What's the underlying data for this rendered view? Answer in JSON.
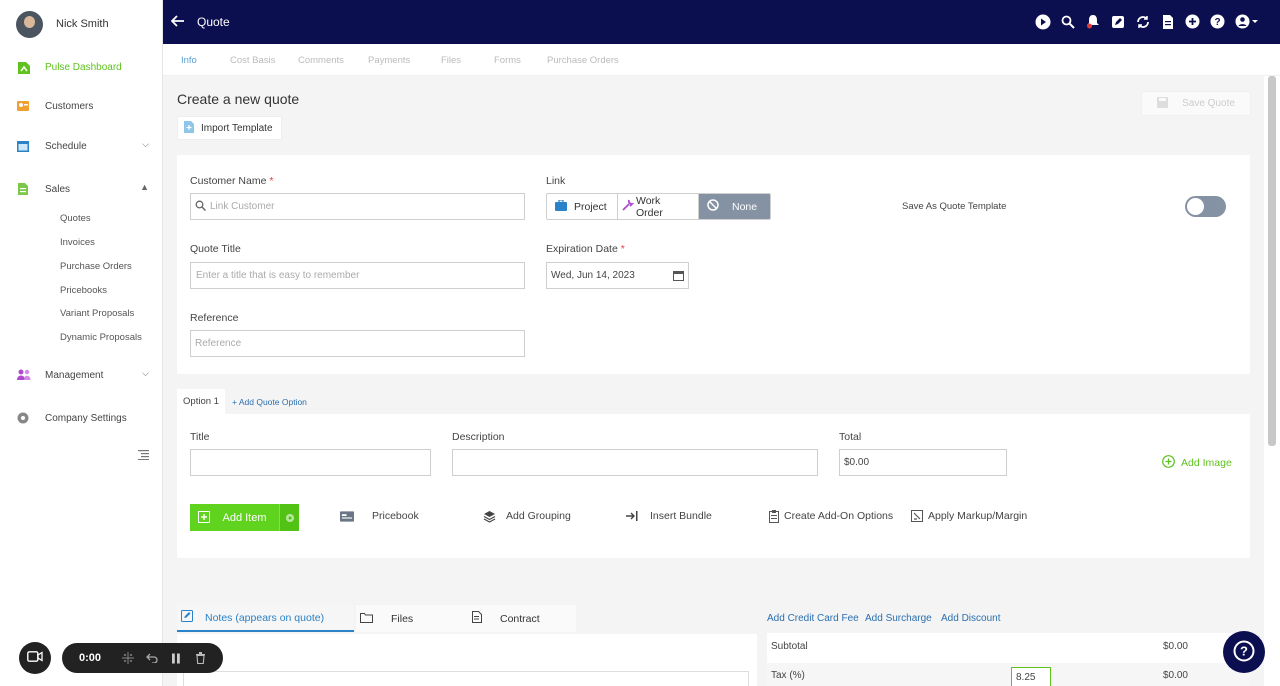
{
  "user": {
    "name": "Nick Smith"
  },
  "sidebar": {
    "items": [
      {
        "label": "Pulse Dashboard",
        "color": "#5fc21d"
      },
      {
        "label": "Customers"
      },
      {
        "label": "Schedule"
      },
      {
        "label": "Sales"
      },
      {
        "label": "Management"
      },
      {
        "label": "Company Settings"
      }
    ],
    "sales_sub": [
      "Quotes",
      "Invoices",
      "Purchase Orders",
      "Pricebooks",
      "Variant Proposals",
      "Dynamic Proposals"
    ]
  },
  "header": {
    "title": "Quote"
  },
  "tabs": [
    "Info",
    "Cost Basis",
    "Comments",
    "Payments",
    "Files",
    "Forms",
    "Purchase Orders"
  ],
  "page": {
    "title": "Create a new quote",
    "import_template": "Import Template",
    "save_quote": "Save Quote"
  },
  "form": {
    "customer_name_label": "Customer Name",
    "required_mark": "*",
    "customer_placeholder": "Link Customer",
    "link_label": "Link",
    "link_options": [
      "Project",
      "Work Order",
      "None"
    ],
    "save_template_label": "Save As Quote Template",
    "quote_title_label": "Quote Title",
    "quote_title_placeholder": "Enter a title that is easy to remember",
    "expiration_label": "Expiration Date",
    "expiration_value": "Wed, Jun 14, 2023",
    "reference_label": "Reference",
    "reference_placeholder": "Reference"
  },
  "option": {
    "tab": "Option 1",
    "add_option": "+ Add Quote Option",
    "title_label": "Title",
    "description_label": "Description",
    "total_label": "Total",
    "total_value": "$0.00",
    "add_image": "Add Image",
    "add_item": "Add Item",
    "actions": [
      "Pricebook",
      "Add Grouping",
      "Insert Bundle",
      "Create Add-On Options",
      "Apply Markup/Margin"
    ]
  },
  "bottom": {
    "tabs": [
      "Notes (appears on quote)",
      "Files",
      "Contract"
    ],
    "fee_links": [
      "Add Credit Card Fee",
      "Add Surcharge",
      "Add Discount"
    ],
    "subtotal_label": "Subtotal",
    "subtotal_value": "$0.00",
    "tax_label": "Tax (%)",
    "tax_rate": "8.25",
    "tax_value": "$0.00"
  },
  "recorder": {
    "time": "0:00"
  },
  "colors": {
    "nav_bg": "#0c0f4f",
    "accent_green": "#5fd31d",
    "link_blue": "#2a6fb0",
    "toggle": "#8592a3"
  }
}
